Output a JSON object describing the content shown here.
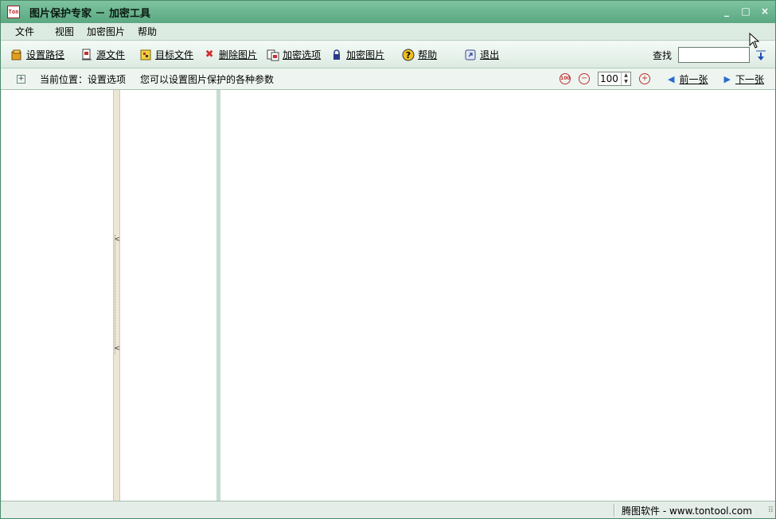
{
  "window": {
    "title": "图片保护专家 － 加密工具",
    "app_icon_text": "Ton",
    "controls": {
      "minimize": "_",
      "maximize": "□",
      "close": "×"
    }
  },
  "menu": {
    "items": [
      "文件",
      "视图",
      "加密图片",
      "帮助"
    ]
  },
  "toolbar": {
    "buttons": [
      {
        "label": "设置路径",
        "icon": "folder-key-icon"
      },
      {
        "label": "源文件",
        "icon": "source-file-icon"
      },
      {
        "label": "目标文件",
        "icon": "target-file-icon"
      },
      {
        "label": "删除图片",
        "icon": "delete-icon"
      },
      {
        "label": "加密选项",
        "icon": "options-icon"
      },
      {
        "label": "加密图片",
        "icon": "lock-icon"
      },
      {
        "label": "帮助",
        "icon": "help-icon"
      },
      {
        "label": "退出",
        "icon": "exit-icon"
      }
    ],
    "search_label": "查找",
    "search_value": ""
  },
  "location": {
    "label": "当前位置：设置选项",
    "description": "您可以设置图片保护的各种参数",
    "zoom_value": "100",
    "zoom_actual_icon": "100",
    "prev_label": "前一张",
    "next_label": "下一张"
  },
  "status": {
    "text": "腾图软件 - www.tontool.com"
  },
  "colors": {
    "titlebar": "#6ab892",
    "accent": "#2a6ad0",
    "delete": "#d03030"
  }
}
